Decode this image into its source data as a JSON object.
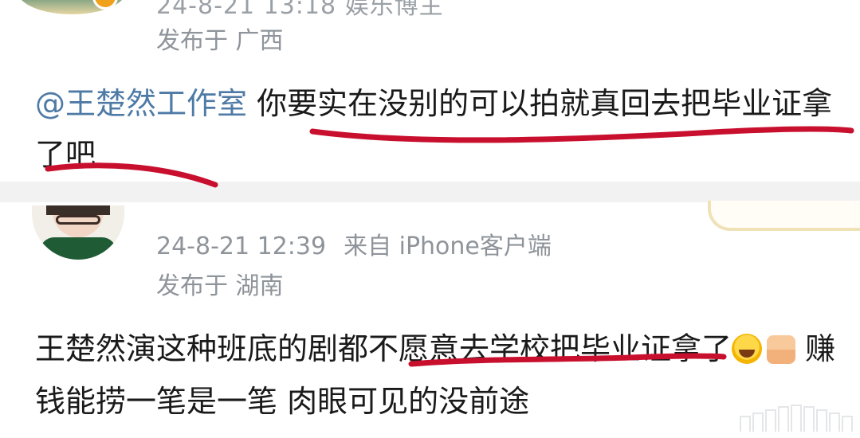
{
  "top_comment": {
    "meta_partial": "24-8-21 13:18 娱乐博主",
    "location": "发布于 广西",
    "mention": "@王楚然工作室",
    "text": " 你要实在没别的可以拍就真回去把毕业证拿了吧"
  },
  "second_comment": {
    "timestamp": "24-8-21 12:39",
    "source": "来自 iPhone客户端",
    "location": "发布于 湖南",
    "text_part1": "王楚然演这种班底的剧都不愿意去学校把毕业证拿了",
    "text_part2": " 赚钱能捞一笔是一笔 肉眼可见的没前途",
    "emojis": [
      "laughing-crying-emoji",
      "thumbs-up-emoji"
    ]
  },
  "colors": {
    "mention_blue": "#4e7aa6",
    "underline_red": "#c8102e",
    "meta_gray": "#8e949a",
    "divider": "#f2f2f2"
  }
}
